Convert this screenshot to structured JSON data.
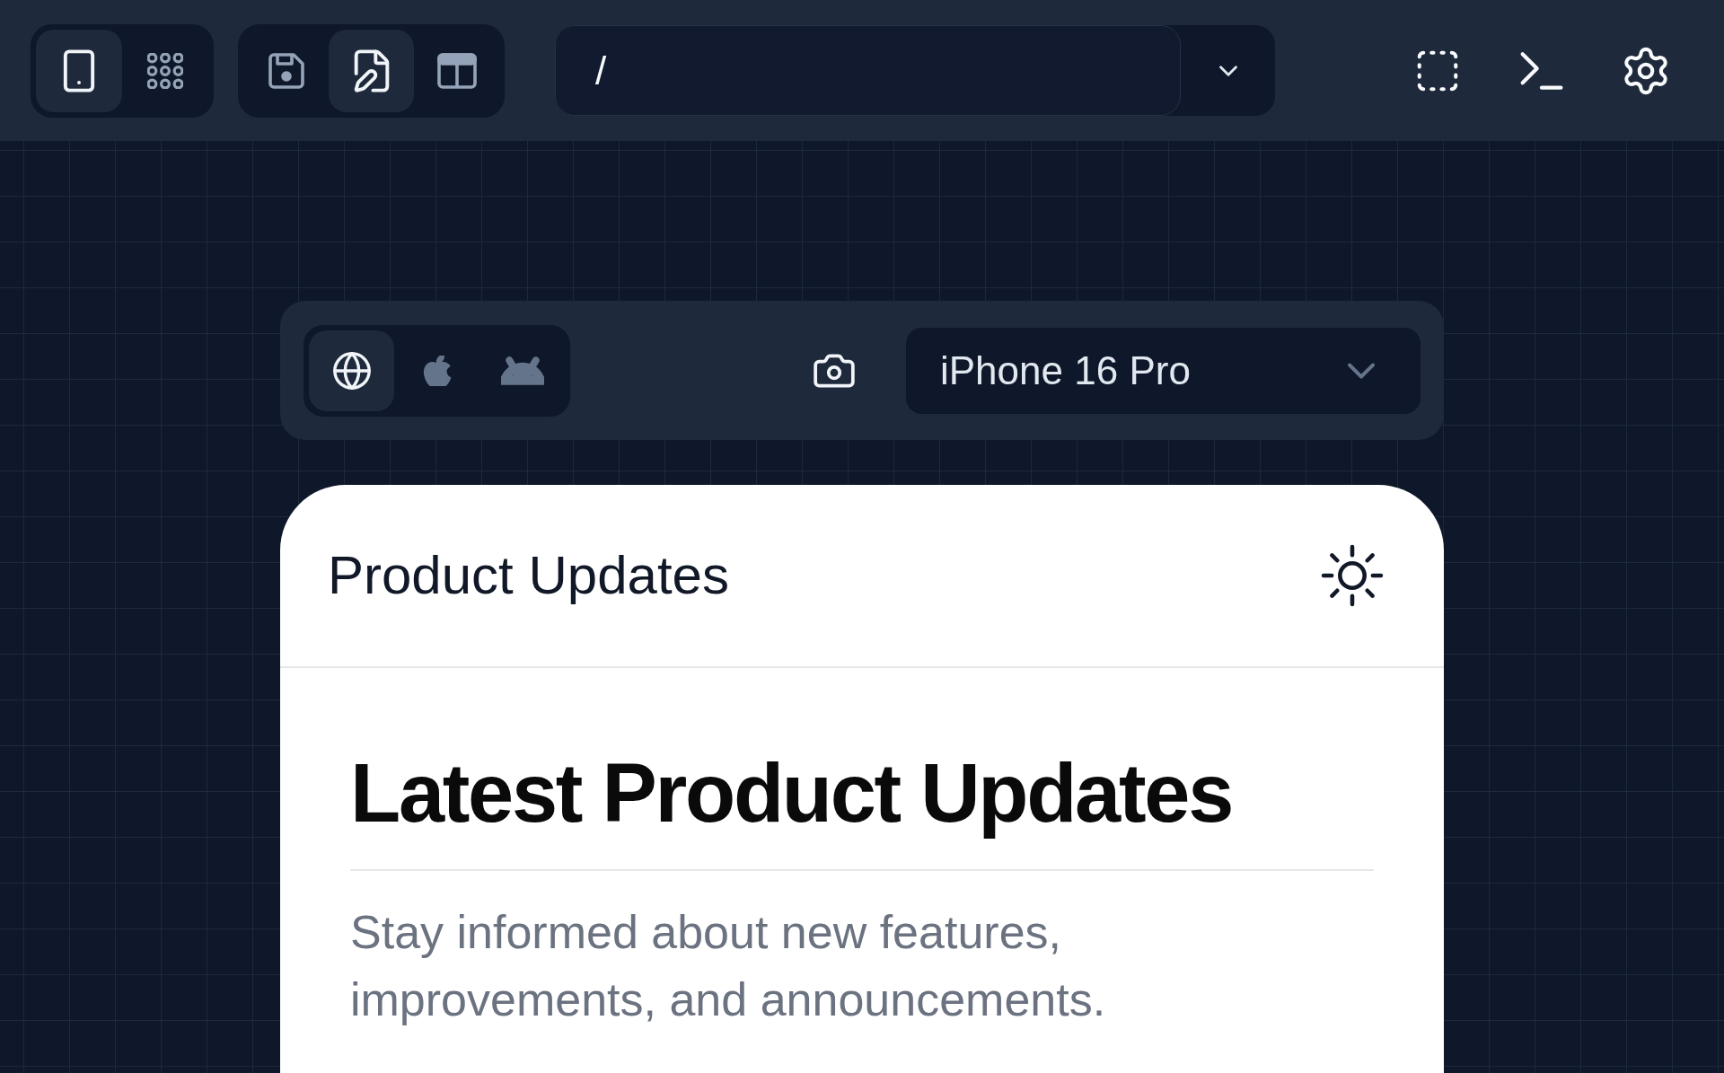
{
  "toolbar": {
    "view_modes": [
      {
        "kind": "device",
        "selected": true
      },
      {
        "kind": "apps",
        "selected": false
      }
    ],
    "tools": [
      {
        "kind": "save",
        "selected": false
      },
      {
        "kind": "edit",
        "selected": true
      },
      {
        "kind": "split",
        "selected": false
      }
    ],
    "path": {
      "value": "/"
    }
  },
  "preview_bar": {
    "platforms": [
      {
        "kind": "web",
        "selected": true
      },
      {
        "kind": "ios",
        "selected": false
      },
      {
        "kind": "android",
        "selected": false
      }
    ],
    "device_select": {
      "value": "iPhone 16 Pro"
    }
  },
  "phone_screen": {
    "header": {
      "title": "Product Updates"
    },
    "heading": "Latest Product Updates",
    "intro": "Stay informed about new features, improvements, and announcements."
  }
}
